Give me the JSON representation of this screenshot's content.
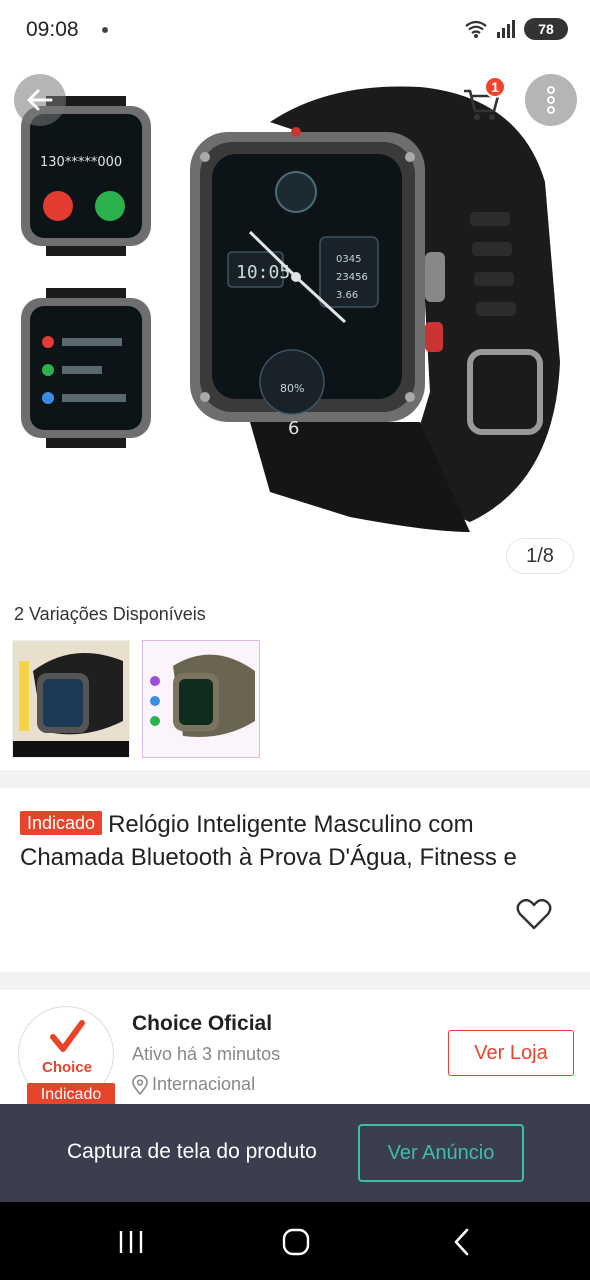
{
  "status_bar": {
    "time": "09:08",
    "battery": "78"
  },
  "header": {
    "cart_count": "1"
  },
  "gallery": {
    "page_indicator": "1/8"
  },
  "variations": {
    "title": "2 Variações Disponíveis"
  },
  "product": {
    "tag": "Indicado",
    "title": "Relógio Inteligente Masculino com Chamada Bluetooth à Prova D'Água, Fitness e"
  },
  "store": {
    "logo_text": "Choice",
    "logo_tag": "Indicado",
    "name": "Choice Oficial",
    "active": "Ativo há 3 minutos",
    "location": "Internacional",
    "visit_label": "Ver Loja"
  },
  "capture": {
    "text": "Captura de tela do produto",
    "button_label": "Ver Anúncio"
  },
  "colors": {
    "accent": "#e8432b",
    "teal": "#3fbcad",
    "overlay": "#3b3f4d"
  }
}
